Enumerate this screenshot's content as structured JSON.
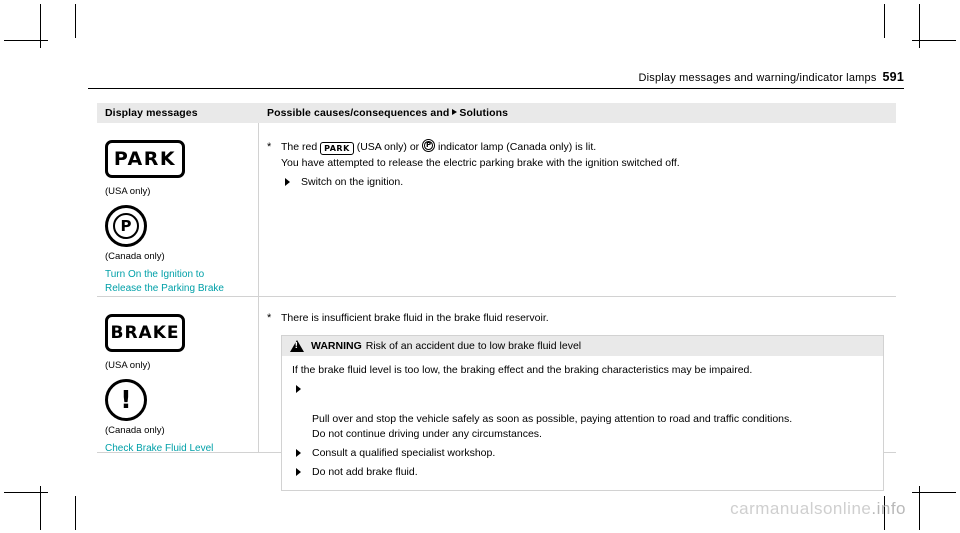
{
  "header": {
    "running_title": "Display messages and warning/indicator lamps",
    "page_number": "591"
  },
  "table": {
    "headers": {
      "col1": "Display messages",
      "col2_prefix": "Possible causes/consequences and",
      "col2_suffix": "Solutions"
    },
    "rows": [
      {
        "symbols": [
          {
            "type": "park-box",
            "label": "PARK",
            "caption": "(USA only)"
          },
          {
            "type": "circle-p",
            "label": "P",
            "caption": "(Canada only)"
          }
        ],
        "message": "Turn On the Ignition to\nRelease the Parking Brake",
        "star_text_part1": "The red",
        "star_text_part2": "(USA only) or",
        "star_text_part3": "indicator lamp (Canada only) is lit.",
        "second_line": "You have attempted to release the electric parking brake with the ignition switched off.",
        "bullets": [
          "Switch on the ignition."
        ]
      },
      {
        "symbols": [
          {
            "type": "brake-box",
            "label": "BRAKE",
            "caption": "(USA only)"
          },
          {
            "type": "circle-excl",
            "label": "!",
            "caption": "(Canada only)"
          }
        ],
        "message": "Check Brake Fluid Level",
        "star_text": "There is insufficient brake fluid in the brake fluid reservoir.",
        "warning": {
          "title": "WARNING",
          "subtitle": "Risk of an accident due to low brake fluid level",
          "body": "If the brake fluid level is too low, the braking effect and the braking characteristics may be impaired.",
          "bullets": [
            "Pull over and stop the vehicle safely as soon as possible, paying attention to road and traffic conditions.\nDo not continue driving under any circumstances.",
            "Consult a qualified specialist workshop.",
            "Do not add brake fluid."
          ]
        }
      }
    ]
  },
  "watermark": {
    "text": "carmanualsonline",
    "suffix": ".info"
  },
  "colors": {
    "teal": "#00a0a8",
    "header_bg": "#e9e9e9",
    "rule": "#d2d2d2"
  }
}
